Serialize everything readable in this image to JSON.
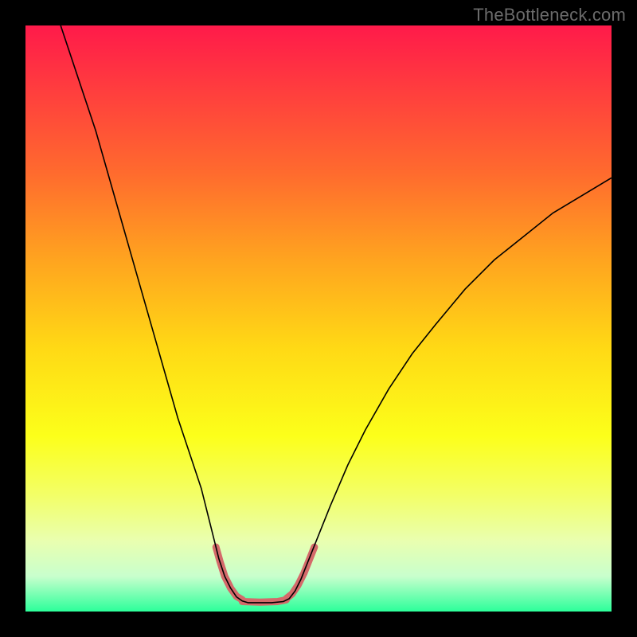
{
  "watermark": "TheBottleneck.com",
  "chart_data": {
    "type": "line",
    "title": "",
    "xlabel": "",
    "ylabel": "",
    "xlim": [
      0,
      100
    ],
    "ylim": [
      0,
      100
    ],
    "grid": false,
    "legend": false,
    "background_gradient": {
      "stops": [
        {
          "offset": 0.0,
          "color": "#ff1a4a"
        },
        {
          "offset": 0.1,
          "color": "#ff3a3f"
        },
        {
          "offset": 0.25,
          "color": "#ff6a2e"
        },
        {
          "offset": 0.4,
          "color": "#ffa41f"
        },
        {
          "offset": 0.55,
          "color": "#ffd915"
        },
        {
          "offset": 0.7,
          "color": "#fcff1a"
        },
        {
          "offset": 0.8,
          "color": "#f3ff66"
        },
        {
          "offset": 0.88,
          "color": "#e9ffb0"
        },
        {
          "offset": 0.94,
          "color": "#c8ffcd"
        },
        {
          "offset": 1.0,
          "color": "#2cff9a"
        }
      ]
    },
    "series": [
      {
        "name": "curve-left",
        "color": "#000000",
        "stroke_width": 1.6,
        "points": [
          {
            "x": 6,
            "y": 100
          },
          {
            "x": 8,
            "y": 94
          },
          {
            "x": 10,
            "y": 88
          },
          {
            "x": 12,
            "y": 82
          },
          {
            "x": 14,
            "y": 75
          },
          {
            "x": 16,
            "y": 68
          },
          {
            "x": 18,
            "y": 61
          },
          {
            "x": 20,
            "y": 54
          },
          {
            "x": 22,
            "y": 47
          },
          {
            "x": 24,
            "y": 40
          },
          {
            "x": 26,
            "y": 33
          },
          {
            "x": 28,
            "y": 27
          },
          {
            "x": 30,
            "y": 21
          },
          {
            "x": 31,
            "y": 17
          },
          {
            "x": 32,
            "y": 13
          },
          {
            "x": 33,
            "y": 9
          },
          {
            "x": 34,
            "y": 6
          },
          {
            "x": 35,
            "y": 4
          },
          {
            "x": 36,
            "y": 2.5
          },
          {
            "x": 37,
            "y": 1.8
          },
          {
            "x": 38,
            "y": 1.5
          },
          {
            "x": 40,
            "y": 1.5
          },
          {
            "x": 42,
            "y": 1.5
          },
          {
            "x": 44,
            "y": 1.7
          },
          {
            "x": 45,
            "y": 2.2
          },
          {
            "x": 46,
            "y": 3.5
          },
          {
            "x": 47,
            "y": 5.5
          },
          {
            "x": 48,
            "y": 8
          },
          {
            "x": 50,
            "y": 13
          },
          {
            "x": 52,
            "y": 18
          },
          {
            "x": 55,
            "y": 25
          },
          {
            "x": 58,
            "y": 31
          },
          {
            "x": 62,
            "y": 38
          },
          {
            "x": 66,
            "y": 44
          },
          {
            "x": 70,
            "y": 49
          },
          {
            "x": 75,
            "y": 55
          },
          {
            "x": 80,
            "y": 60
          },
          {
            "x": 85,
            "y": 64
          },
          {
            "x": 90,
            "y": 68
          },
          {
            "x": 95,
            "y": 71
          },
          {
            "x": 100,
            "y": 74
          }
        ]
      },
      {
        "name": "highlight-segments",
        "color": "#d46a6a",
        "stroke_width": 9,
        "linecap": "round",
        "points_groups": [
          [
            {
              "x": 32.5,
              "y": 11
            },
            {
              "x": 33.2,
              "y": 8.5
            },
            {
              "x": 34.0,
              "y": 6.0
            },
            {
              "x": 35.0,
              "y": 4.0
            },
            {
              "x": 36.0,
              "y": 2.6
            },
            {
              "x": 37.0,
              "y": 2.0
            }
          ],
          [
            {
              "x": 37.0,
              "y": 1.7
            },
            {
              "x": 40.0,
              "y": 1.6
            },
            {
              "x": 43.0,
              "y": 1.7
            },
            {
              "x": 44.5,
              "y": 2.0
            }
          ],
          [
            {
              "x": 44.5,
              "y": 2.2
            },
            {
              "x": 45.5,
              "y": 3.0
            },
            {
              "x": 46.5,
              "y": 4.5
            },
            {
              "x": 47.5,
              "y": 6.5
            },
            {
              "x": 48.5,
              "y": 9.0
            },
            {
              "x": 49.3,
              "y": 11.0
            }
          ]
        ]
      }
    ]
  }
}
